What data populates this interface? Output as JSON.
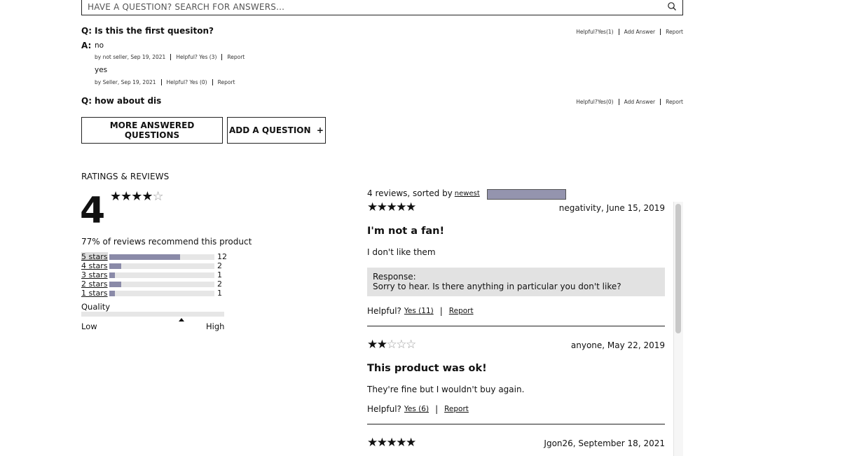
{
  "search": {
    "placeholder": "HAVE A QUESTION? SEARCH FOR ANSWERS..."
  },
  "questions": [
    {
      "q_prefix": "Q:",
      "text": "Is this the first quesiton?",
      "helpful": "Helpful?Yes(1)",
      "add_answer": "Add Answer",
      "report": "Report",
      "answers": [
        {
          "a_prefix": "A:",
          "body": "no",
          "meta": "by not seller, Sep 19, 2021",
          "helpful": "Helpful? Yes (3)",
          "report": "Report"
        },
        {
          "body": "yes",
          "meta": "by Seller, Sep 19, 2021",
          "helpful": "Helpful? Yes (0)",
          "report": "Report"
        }
      ]
    },
    {
      "q_prefix": "Q:",
      "text": "how about dis",
      "helpful": "Helpful?Yes(0)",
      "add_answer": "Add Answer",
      "report": "Report",
      "answers": []
    }
  ],
  "buttons": {
    "more_answered": "MORE ANSWERED QUESTIONS",
    "add_question": "ADD A QUESTION  +"
  },
  "ratings": {
    "title": "RATINGS & REVIEWS",
    "average": "4",
    "average_stars": {
      "filled": "★★★★",
      "empty": "☆"
    },
    "recommend": "77% of reviews recommend this product",
    "breakdown": [
      {
        "label": "5 stars",
        "count": "12",
        "fraction": 0.67
      },
      {
        "label": "4 stars",
        "count": "2",
        "fraction": 0.11
      },
      {
        "label": "3 stars",
        "count": "1",
        "fraction": 0.05
      },
      {
        "label": "2 stars",
        "count": "2",
        "fraction": 0.11
      },
      {
        "label": "1 stars",
        "count": "1",
        "fraction": 0.05
      }
    ],
    "quality": {
      "label": "Quality",
      "low": "Low",
      "high": "High",
      "level": 0.7
    }
  },
  "reviews_header": {
    "prefix": "4 reviews, sorted by",
    "sort_value": "newest"
  },
  "reviews": [
    {
      "stars_filled": "★★★★★",
      "stars_empty": "",
      "author_date": "negativity, June 15, 2019",
      "title": "I'm not a fan!",
      "body": "I don't like them",
      "response_label": "Response:",
      "response_text": "Sorry to hear. Is there anything in particular you don't like?",
      "helpful_label": "Helpful?",
      "helpful_yes": "Yes (11)",
      "report": "Report"
    },
    {
      "stars_filled": "★★",
      "stars_empty": "☆☆☆",
      "author_date": "anyone, May 22, 2019",
      "title": "This product was ok!",
      "body": "They're fine but I wouldn't buy again.",
      "helpful_label": "Helpful?",
      "helpful_yes": "Yes (6)",
      "report": "Report"
    },
    {
      "stars_filled": "★★★★★",
      "stars_empty": "",
      "author_date": "Jgon26, September 18, 2021"
    }
  ]
}
